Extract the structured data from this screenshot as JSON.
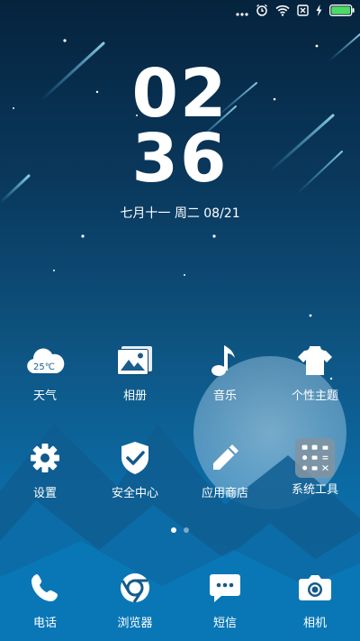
{
  "status_bar": {
    "icons": [
      "more-dots-icon",
      "alarm-icon",
      "wifi-icon",
      "no-sim-icon",
      "charging-icon",
      "battery-icon"
    ]
  },
  "lock_clock": {
    "hours": "02",
    "minutes": "36",
    "date": "七月十一  周二 08/21"
  },
  "home_rows": [
    [
      {
        "label": "天气",
        "icon": "weather-cloud-icon",
        "badge": "25℃"
      },
      {
        "label": "相册",
        "icon": "gallery-icon"
      },
      {
        "label": "音乐",
        "icon": "music-note-icon"
      },
      {
        "label": "个性主题",
        "icon": "theme-shirt-icon"
      }
    ],
    [
      {
        "label": "设置",
        "icon": "gear-icon"
      },
      {
        "label": "安全中心",
        "icon": "security-shield-icon"
      },
      {
        "label": "应用商店",
        "icon": "app-store-pencil-icon"
      },
      {
        "label": "系统工具",
        "icon": "folder-icon"
      }
    ]
  ],
  "page_indicator": {
    "count": 2,
    "active": 1
  },
  "dock": [
    {
      "label": "电话",
      "icon": "phone-icon"
    },
    {
      "label": "浏览器",
      "icon": "browser-icon"
    },
    {
      "label": "短信",
      "icon": "messages-icon"
    },
    {
      "label": "相机",
      "icon": "camera-icon"
    }
  ],
  "colors": {
    "battery_fill": "#4cd964",
    "text": "#ffffff"
  }
}
